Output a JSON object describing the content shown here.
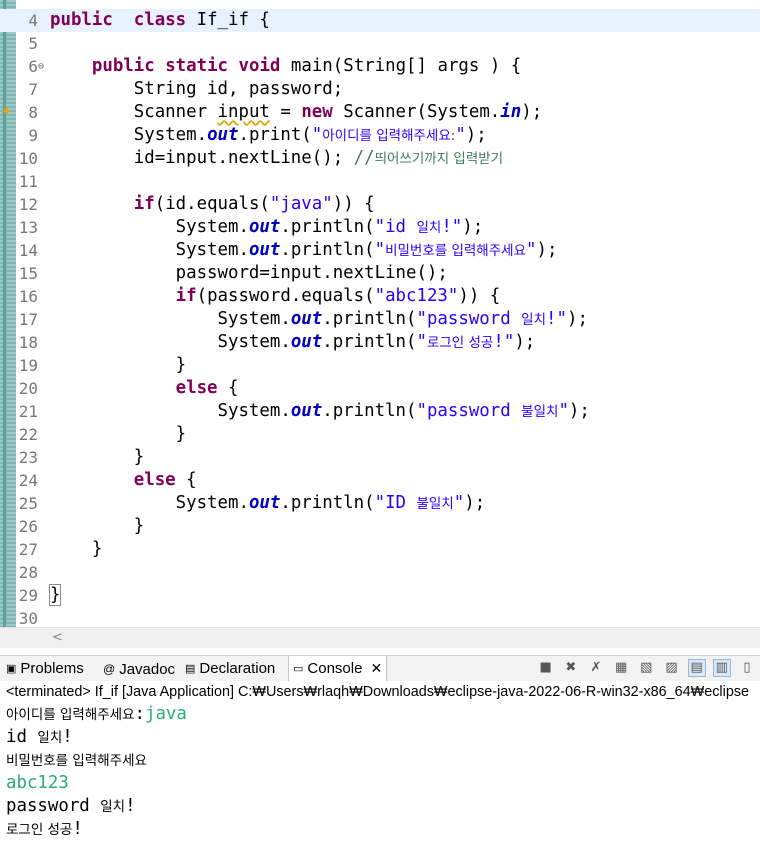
{
  "editor": {
    "lines": [
      {
        "n": "4",
        "tokens": [
          [
            "kw",
            "public"
          ],
          [
            "",
            "  "
          ],
          [
            "kw",
            "class"
          ],
          [
            "",
            " If_if {"
          ]
        ]
      },
      {
        "n": "5",
        "tokens": []
      },
      {
        "n": "6",
        "fold": "⊖",
        "tokens": [
          [
            "",
            "    "
          ],
          [
            "kw",
            "public"
          ],
          [
            "",
            " "
          ],
          [
            "kw",
            "static"
          ],
          [
            "",
            " "
          ],
          [
            "kw",
            "void"
          ],
          [
            "",
            " main(String[] "
          ],
          [
            "",
            "args"
          ],
          [
            "",
            " ) {"
          ]
        ]
      },
      {
        "n": "7",
        "tokens": [
          [
            "",
            "        String id, password;"
          ]
        ]
      },
      {
        "n": "8",
        "tokens": [
          [
            "",
            "        Scanner "
          ],
          [
            "warn",
            "input"
          ],
          [
            "",
            " = "
          ],
          [
            "kw",
            "new"
          ],
          [
            "",
            " Scanner(System."
          ],
          [
            "fld",
            "in"
          ],
          [
            "",
            ");"
          ]
        ]
      },
      {
        "n": "9",
        "tokens": [
          [
            "",
            "        System."
          ],
          [
            "fld",
            "out"
          ],
          [
            "",
            ".print("
          ],
          [
            "str",
            "\""
          ],
          [
            "strko",
            "아이디를 입력해주세요:"
          ],
          [
            "str",
            "\""
          ],
          [
            "",
            ");"
          ]
        ]
      },
      {
        "n": "10",
        "tokens": [
          [
            "",
            "        id=input.nextLine(); "
          ],
          [
            "com",
            "//"
          ],
          [
            "comko",
            "띄어쓰기까지 입력받기"
          ]
        ]
      },
      {
        "n": "11",
        "tokens": []
      },
      {
        "n": "12",
        "tokens": [
          [
            "",
            "        "
          ],
          [
            "kw",
            "if"
          ],
          [
            "",
            "(id.equals("
          ],
          [
            "str",
            "\"java\""
          ],
          [
            "",
            ")) {"
          ]
        ]
      },
      {
        "n": "13",
        "tokens": [
          [
            "",
            "            System."
          ],
          [
            "fld",
            "out"
          ],
          [
            "",
            ".println("
          ],
          [
            "str",
            "\"id "
          ],
          [
            "strko",
            "일치"
          ],
          [
            "str",
            "!\""
          ],
          [
            "",
            ");"
          ]
        ]
      },
      {
        "n": "14",
        "tokens": [
          [
            "",
            "            System."
          ],
          [
            "fld",
            "out"
          ],
          [
            "",
            ".println("
          ],
          [
            "str",
            "\""
          ],
          [
            "strko",
            "비밀번호를 입력해주세요"
          ],
          [
            "str",
            "\""
          ],
          [
            "",
            ");"
          ]
        ]
      },
      {
        "n": "15",
        "tokens": [
          [
            "",
            "            password=input.nextLine();"
          ]
        ]
      },
      {
        "n": "16",
        "tokens": [
          [
            "",
            "            "
          ],
          [
            "kw",
            "if"
          ],
          [
            "",
            "(password.equals("
          ],
          [
            "str",
            "\"abc123\""
          ],
          [
            "",
            ")) {"
          ]
        ]
      },
      {
        "n": "17",
        "tokens": [
          [
            "",
            "                System."
          ],
          [
            "fld",
            "out"
          ],
          [
            "",
            ".println("
          ],
          [
            "str",
            "\"password "
          ],
          [
            "strko",
            "일치"
          ],
          [
            "str",
            "!\""
          ],
          [
            "",
            ");"
          ]
        ]
      },
      {
        "n": "18",
        "tokens": [
          [
            "",
            "                System."
          ],
          [
            "fld",
            "out"
          ],
          [
            "",
            ".println("
          ],
          [
            "str",
            "\""
          ],
          [
            "strko",
            "로그인 성공"
          ],
          [
            "str",
            "!\""
          ],
          [
            "",
            ");"
          ]
        ]
      },
      {
        "n": "19",
        "tokens": [
          [
            "",
            "            }"
          ]
        ]
      },
      {
        "n": "20",
        "tokens": [
          [
            "",
            "            "
          ],
          [
            "kw",
            "else"
          ],
          [
            "",
            " {"
          ]
        ]
      },
      {
        "n": "21",
        "tokens": [
          [
            "",
            "                System."
          ],
          [
            "fld",
            "out"
          ],
          [
            "",
            ".println("
          ],
          [
            "str",
            "\"password "
          ],
          [
            "strko",
            "불일치"
          ],
          [
            "str",
            "\""
          ],
          [
            "",
            ");"
          ]
        ]
      },
      {
        "n": "22",
        "tokens": [
          [
            "",
            "            }"
          ]
        ]
      },
      {
        "n": "23",
        "tokens": [
          [
            "",
            "        }"
          ]
        ]
      },
      {
        "n": "24",
        "tokens": [
          [
            "",
            "        "
          ],
          [
            "kw",
            "else"
          ],
          [
            "",
            " {"
          ]
        ]
      },
      {
        "n": "25",
        "tokens": [
          [
            "",
            "            System."
          ],
          [
            "fld",
            "out"
          ],
          [
            "",
            ".println("
          ],
          [
            "str",
            "\"ID "
          ],
          [
            "strko",
            "불일치"
          ],
          [
            "str",
            "\""
          ],
          [
            "",
            ");"
          ]
        ]
      },
      {
        "n": "26",
        "tokens": [
          [
            "",
            "        }"
          ]
        ]
      },
      {
        "n": "27",
        "tokens": [
          [
            "",
            "    }"
          ]
        ]
      },
      {
        "n": "28",
        "tokens": []
      },
      {
        "n": "29",
        "tokens": [
          [
            "hl",
            "}"
          ]
        ]
      },
      {
        "n": "30",
        "tokens": []
      }
    ]
  },
  "console": {
    "tabs": {
      "problems": "Problems",
      "javadoc": "Javadoc",
      "declaration": "Declaration",
      "console": "Console"
    },
    "info": "<terminated> If_if [Java Application] C:₩Users₩rlaqh₩Downloads₩eclipse-java-2022-06-R-win32-x86_64₩eclipse",
    "output": [
      {
        "prompt": "아이디를 입력해주세요:",
        "input": "java"
      },
      {
        "text": "id 일치!"
      },
      {
        "text": "비밀번호를 입력해주세요"
      },
      {
        "input_line": "abc123"
      },
      {
        "text": "password 일치!"
      },
      {
        "text": "로그인 성공!"
      }
    ]
  },
  "colors": {
    "keyword": "#7f0055",
    "string": "#2a00ff",
    "field": "#0000c0",
    "comment": "#3f7f5f",
    "console_input": "#2aae74",
    "current_line": "#e8f2fe"
  }
}
